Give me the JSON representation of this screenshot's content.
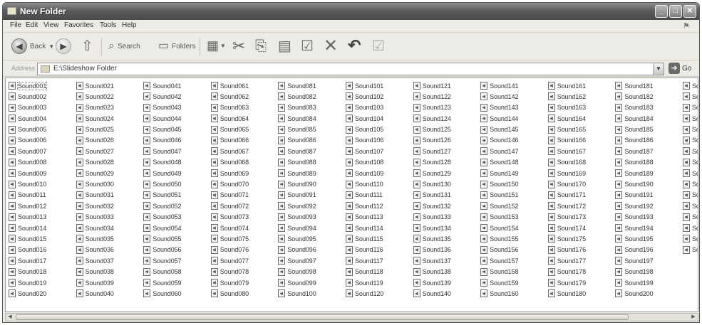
{
  "window": {
    "title": "New Folder"
  },
  "menu": {
    "items": [
      "File",
      "Edit",
      "View",
      "Favorites",
      "Tools",
      "Help"
    ]
  },
  "toolbar": {
    "back_label": "Back",
    "search_label": "Search",
    "folders_label": "Folders"
  },
  "address": {
    "label": "Address",
    "path": "E:\\Slideshow Folder",
    "go_label": "Go"
  },
  "files": [
    "Sound001",
    "Sound002",
    "Sound003",
    "Sound004",
    "Sound005",
    "Sound006",
    "Sound007",
    "Sound008",
    "Sound009",
    "Sound010",
    "Sound011",
    "Sound012",
    "Sound013",
    "Sound014",
    "Sound015",
    "Sound016",
    "Sound017",
    "Sound018",
    "Sound019",
    "Sound020",
    "Sound021",
    "Sound022",
    "Sound023",
    "Sound024",
    "Sound025",
    "Sound026",
    "Sound027",
    "Sound028",
    "Sound029",
    "Sound030",
    "Sound031",
    "Sound032",
    "Sound033",
    "Sound034",
    "Sound035",
    "Sound036",
    "Sound037",
    "Sound038",
    "Sound039",
    "Sound040",
    "Sound041",
    "Sound042",
    "Sound043",
    "Sound044",
    "Sound045",
    "Sound046",
    "Sound047",
    "Sound048",
    "Sound049",
    "Sound050",
    "Sound051",
    "Sound052",
    "Sound053",
    "Sound054",
    "Sound055",
    "Sound056",
    "Sound057",
    "Sound058",
    "Sound059",
    "Sound060",
    "Sound061",
    "Sound062",
    "Sound063",
    "Sound064",
    "Sound065",
    "Sound066",
    "Sound067",
    "Sound068",
    "Sound069",
    "Sound070",
    "Sound071",
    "Sound072",
    "Sound073",
    "Sound074",
    "Sound075",
    "Sound076",
    "Sound077",
    "Sound078",
    "Sound079",
    "Sound080",
    "Sound081",
    "Sound082",
    "Sound083",
    "Sound084",
    "Sound085",
    "Sound086",
    "Sound087",
    "Sound088",
    "Sound089",
    "Sound090",
    "Sound091",
    "Sound092",
    "Sound093",
    "Sound094",
    "Sound095",
    "Sound096",
    "Sound097",
    "Sound098",
    "Sound099",
    "Sound100",
    "Sound101",
    "Sound102",
    "Sound103",
    "Sound104",
    "Sound105",
    "Sound106",
    "Sound107",
    "Sound108",
    "Sound109",
    "Sound110",
    "Sound111",
    "Sound112",
    "Sound113",
    "Sound114",
    "Sound115",
    "Sound116",
    "Sound117",
    "Sound118",
    "Sound119",
    "Sound120",
    "Sound121",
    "Sound122",
    "Sound123",
    "Sound124",
    "Sound125",
    "Sound126",
    "Sound127",
    "Sound128",
    "Sound129",
    "Sound130",
    "Sound131",
    "Sound132",
    "Sound133",
    "Sound134",
    "Sound135",
    "Sound136",
    "Sound137",
    "Sound138",
    "Sound139",
    "Sound140",
    "Sound141",
    "Sound142",
    "Sound143",
    "Sound144",
    "Sound145",
    "Sound146",
    "Sound147",
    "Sound148",
    "Sound149",
    "Sound150",
    "Sound151",
    "Sound152",
    "Sound153",
    "Sound154",
    "Sound155",
    "Sound156",
    "Sound157",
    "Sound158",
    "Sound159",
    "Sound160",
    "Sound161",
    "Sound162",
    "Sound163",
    "Sound164",
    "Sound165",
    "Sound166",
    "Sound167",
    "Sound168",
    "Sound169",
    "Sound170",
    "Sound171",
    "Sound172",
    "Sound173",
    "Sound174",
    "Sound175",
    "Sound176",
    "Sound177",
    "Sound178",
    "Sound179",
    "Sound180",
    "Sound181",
    "Sound182",
    "Sound183",
    "Sound184",
    "Sound185",
    "Sound186",
    "Sound187",
    "Sound188",
    "Sound189",
    "Sound190",
    "Sound191",
    "Sound192",
    "Sound193",
    "Sound194",
    "Sound195",
    "Sound196",
    "Sound197",
    "Sound198",
    "Sound199",
    "Sound200",
    "Sou",
    "Sou",
    "Sou",
    "Sou",
    "Sou",
    "Sou",
    "Sou",
    "Sou",
    "Sou",
    "Sou",
    "Sou",
    "Sou",
    "Sou",
    "Sou",
    "Sou",
    "Sou"
  ]
}
